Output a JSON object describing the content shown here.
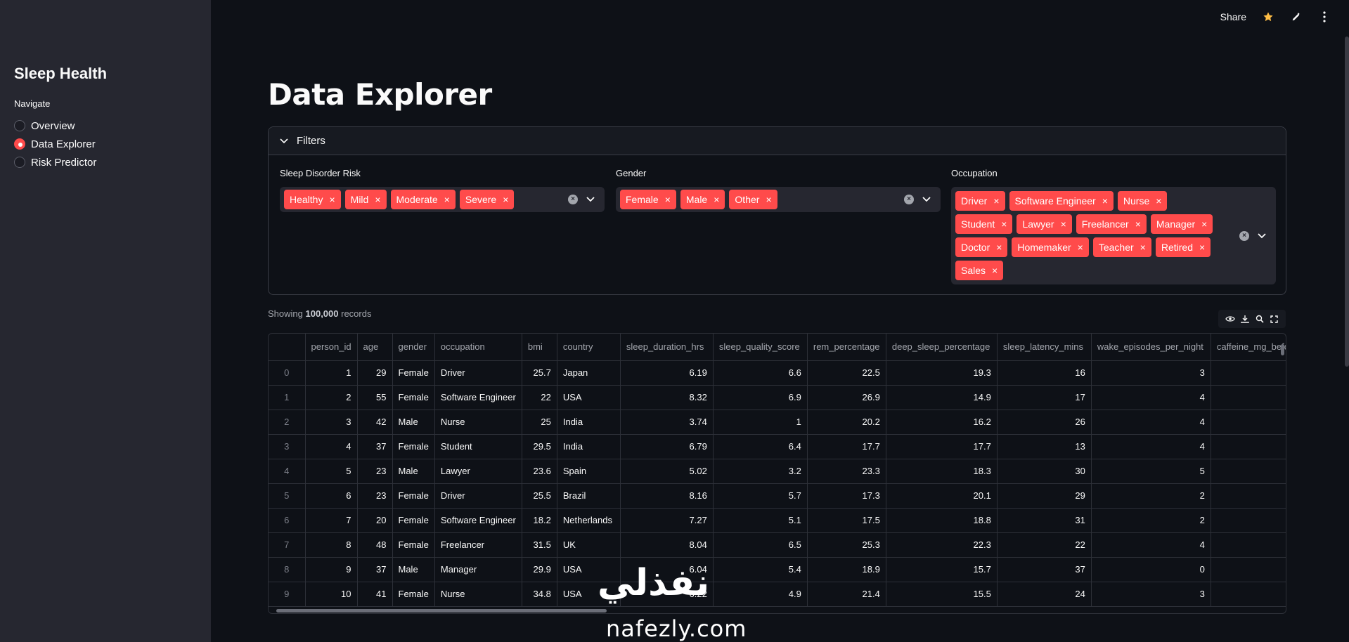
{
  "sidebar": {
    "title": "Sleep Health",
    "nav_label": "Navigate",
    "items": [
      {
        "label": "Overview",
        "selected": false
      },
      {
        "label": "Data Explorer",
        "selected": true
      },
      {
        "label": "Risk Predictor",
        "selected": false
      }
    ]
  },
  "header": {
    "share_label": "Share"
  },
  "page": {
    "title": "Data Explorer"
  },
  "filters": {
    "label": "Filters",
    "risk": {
      "label": "Sleep Disorder Risk",
      "tags": [
        "Healthy",
        "Mild",
        "Moderate",
        "Severe"
      ]
    },
    "gender": {
      "label": "Gender",
      "tags": [
        "Female",
        "Male",
        "Other"
      ]
    },
    "occupation": {
      "label": "Occupation",
      "tags": [
        "Driver",
        "Software Engineer",
        "Nurse",
        "Student",
        "Lawyer",
        "Freelancer",
        "Manager",
        "Doctor",
        "Homemaker",
        "Teacher",
        "Retired",
        "Sales"
      ]
    }
  },
  "records": {
    "prefix": "Showing",
    "count": "100,000",
    "suffix": "records"
  },
  "table": {
    "columns": [
      "",
      "person_id",
      "age",
      "gender",
      "occupation",
      "bmi",
      "country",
      "sleep_duration_hrs",
      "sleep_quality_score",
      "rem_percentage",
      "deep_sleep_percentage",
      "sleep_latency_mins",
      "wake_episodes_per_night",
      "caffeine_mg_befo"
    ],
    "rows": [
      [
        "0",
        "1",
        "29",
        "Female",
        "Driver",
        "25.7",
        "Japan",
        "6.19",
        "6.6",
        "22.5",
        "19.3",
        "16",
        "3",
        ""
      ],
      [
        "1",
        "2",
        "55",
        "Female",
        "Software Engineer",
        "22",
        "USA",
        "8.32",
        "6.9",
        "26.9",
        "14.9",
        "17",
        "4",
        ""
      ],
      [
        "2",
        "3",
        "42",
        "Male",
        "Nurse",
        "25",
        "India",
        "3.74",
        "1",
        "20.2",
        "16.2",
        "26",
        "4",
        ""
      ],
      [
        "3",
        "4",
        "37",
        "Female",
        "Student",
        "29.5",
        "India",
        "6.79",
        "6.4",
        "17.7",
        "17.7",
        "13",
        "4",
        ""
      ],
      [
        "4",
        "5",
        "23",
        "Male",
        "Lawyer",
        "23.6",
        "Spain",
        "5.02",
        "3.2",
        "23.3",
        "18.3",
        "30",
        "5",
        ""
      ],
      [
        "5",
        "6",
        "23",
        "Female",
        "Driver",
        "25.5",
        "Brazil",
        "8.16",
        "5.7",
        "17.3",
        "20.1",
        "29",
        "2",
        ""
      ],
      [
        "6",
        "7",
        "20",
        "Female",
        "Software Engineer",
        "18.2",
        "Netherlands",
        "7.27",
        "5.1",
        "17.5",
        "18.8",
        "31",
        "2",
        ""
      ],
      [
        "7",
        "8",
        "48",
        "Female",
        "Freelancer",
        "31.5",
        "UK",
        "8.04",
        "6.5",
        "25.3",
        "22.3",
        "22",
        "4",
        ""
      ],
      [
        "8",
        "9",
        "37",
        "Male",
        "Manager",
        "29.9",
        "USA",
        "6.04",
        "5.4",
        "18.9",
        "15.7",
        "37",
        "0",
        ""
      ],
      [
        "9",
        "10",
        "41",
        "Female",
        "Nurse",
        "34.8",
        "USA",
        "6.22",
        "4.9",
        "21.4",
        "15.5",
        "24",
        "3",
        ""
      ]
    ]
  },
  "watermark": {
    "arabic": "نفذلي",
    "latin": "nafezly.com"
  },
  "colors": {
    "accent": "#ff4b4b",
    "bg": "#0e1117",
    "sidebar": "#262730"
  }
}
